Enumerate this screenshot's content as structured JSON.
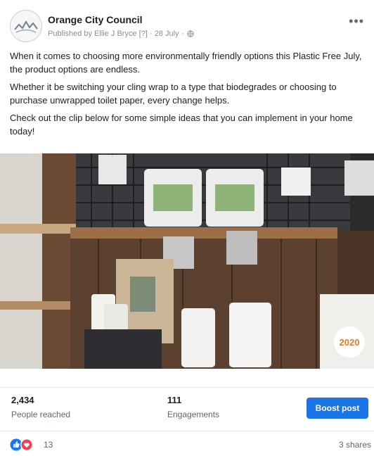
{
  "post": {
    "page_name": "Orange City Council",
    "published_by": "Published by Ellie J Bryce",
    "help_marker": "[?]",
    "date": "28 July",
    "paragraphs": [
      "When it comes to choosing more environmentally friendly options this Plastic Free July, the product options are endless.",
      "Whether it be switching your cling wrap to a type that biodegrades or choosing to purchase unwrapped toilet paper, every change helps.",
      "Check out the clip below for some simple ideas that you can implement in your home today!"
    ],
    "media_badge": "2020",
    "more_icon": "more-options-icon"
  },
  "stats": {
    "reached_value": "2,434",
    "reached_label": "People reached",
    "engagements_value": "111",
    "engagements_label": "Engagements",
    "boost_label": "Boost post"
  },
  "reactions": {
    "count": "13",
    "shares": "3 shares",
    "icons": [
      "like-icon",
      "love-icon"
    ]
  },
  "colors": {
    "accent": "#1b74e4",
    "muted_text": "#606770"
  }
}
